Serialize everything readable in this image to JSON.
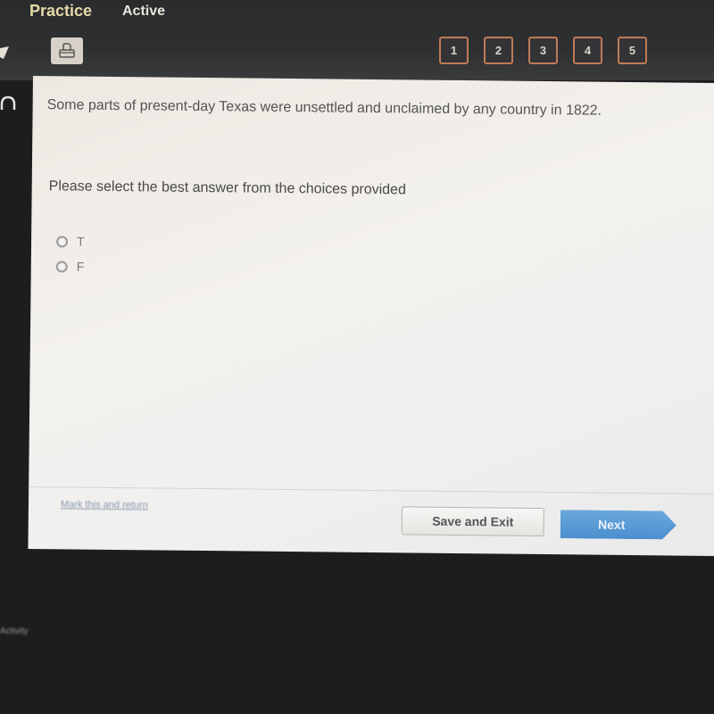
{
  "header": {
    "tabs": [
      {
        "label": "Practice"
      },
      {
        "label": "Active"
      }
    ],
    "print_icon": "printer-icon",
    "question_nav": [
      "1",
      "2",
      "3",
      "4",
      "5"
    ],
    "colors": {
      "nav_border": "#c07a55",
      "practice_tab": "#e6d9a8"
    }
  },
  "sidebar": {
    "icons": [
      "pencil-icon",
      "headphones-icon"
    ]
  },
  "question": {
    "text": "Some parts of present-day Texas were unsettled and unclaimed by any country in 1822.",
    "instruction": "Please select the best answer from the choices provided",
    "choices": [
      {
        "label": "T",
        "selected": false
      },
      {
        "label": "F",
        "selected": false
      }
    ]
  },
  "footer": {
    "mark_link": "Mark this and return",
    "save_exit": "Save and Exit",
    "next": "Next",
    "colors": {
      "next_bg": "#5a9bd5"
    }
  },
  "bottom": {
    "text": "Activity"
  }
}
